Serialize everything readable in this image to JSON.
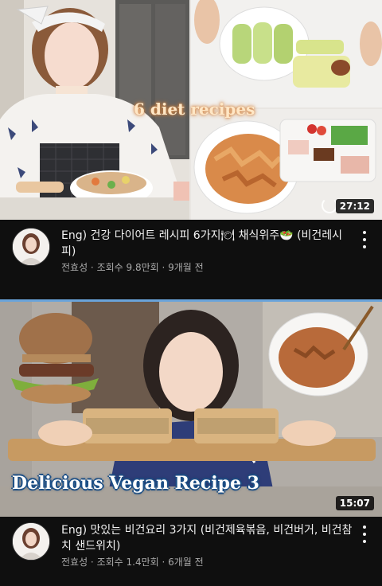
{
  "videos": [
    {
      "thumbnail_caption": "6 diet recipes",
      "duration": "27:12",
      "title": "Eng) 건강 다이어트 레시피 6가지🍽 채식위주🥗 (비건레시피)",
      "channel": "전효성",
      "meta": "전효성 · 조회수 9.8만회 · 9개월 전"
    },
    {
      "thumbnail_caption": "Delicious Vegan Recipe 3",
      "duration": "15:07",
      "title": "Eng) 맛있는 비건요리 3가지 (비건제육볶음, 비건버거, 비건참치 샌드위치)",
      "channel": "전효성",
      "meta": "전효성 · 조회수 1.4만회 · 6개월 전"
    }
  ],
  "colors": {
    "background": "#0f0f0f",
    "title": "#f1f1f1",
    "meta": "#aaaaaa",
    "accent_border": "#6aa4da"
  },
  "icons": {
    "more": "more-vert-icon",
    "loading": "loading-ring-icon"
  }
}
